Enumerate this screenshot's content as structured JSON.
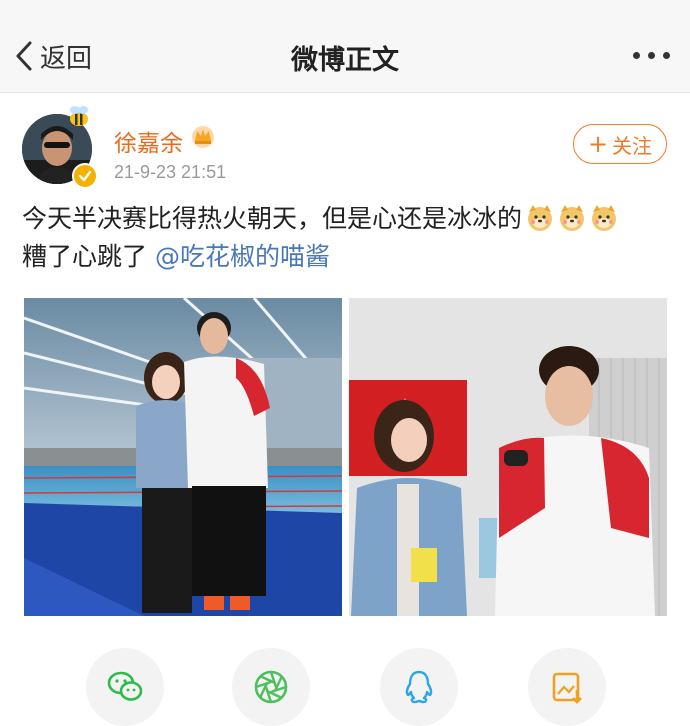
{
  "nav": {
    "back_label": "返回",
    "title": "微博正文"
  },
  "post": {
    "author_name": "徐嘉余",
    "time": "21-9-23 21:51",
    "follow_label": "关注",
    "text_line1": "今天半决赛比得热火朝天，但是心还是冰冰的",
    "text_line2_prefix": "糟了心跳了 ",
    "mention": "@吃花椒的喵酱",
    "emoji_count": 3
  },
  "images": [
    {
      "name": "photo-poolside"
    },
    {
      "name": "photo-interview"
    }
  ],
  "share": [
    "wechat-icon",
    "moments-icon",
    "qq-icon",
    "save-icon"
  ],
  "colors": {
    "accent": "#f07a2b",
    "author_name": "#e86a1b",
    "link": "#4a78b7",
    "nav_bg": "#f7f7f7"
  }
}
